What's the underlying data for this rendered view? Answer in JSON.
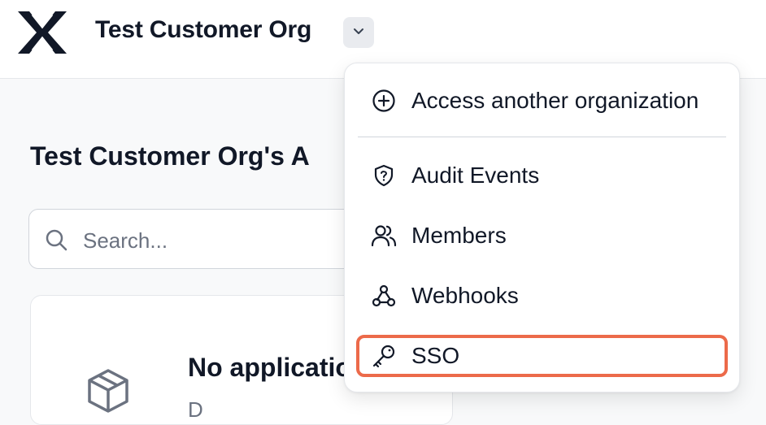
{
  "header": {
    "org_name": "Test Customer Org"
  },
  "main": {
    "heading": "Test Customer Org's A",
    "search": {
      "placeholder": "Search..."
    },
    "empty_state": {
      "title": "No applicatio",
      "subtitle": "D"
    }
  },
  "org_menu": {
    "items": [
      {
        "label": "Access another organization",
        "icon": "plus-circle-icon"
      },
      {
        "label": "Audit Events",
        "icon": "shield-question-icon"
      },
      {
        "label": "Members",
        "icon": "users-icon"
      },
      {
        "label": "Webhooks",
        "icon": "webhook-icon"
      },
      {
        "label": "SSO",
        "icon": "key-icon"
      }
    ]
  },
  "colors": {
    "highlight": "#ec6a4a",
    "text": "#111827",
    "muted": "#6b7280"
  }
}
